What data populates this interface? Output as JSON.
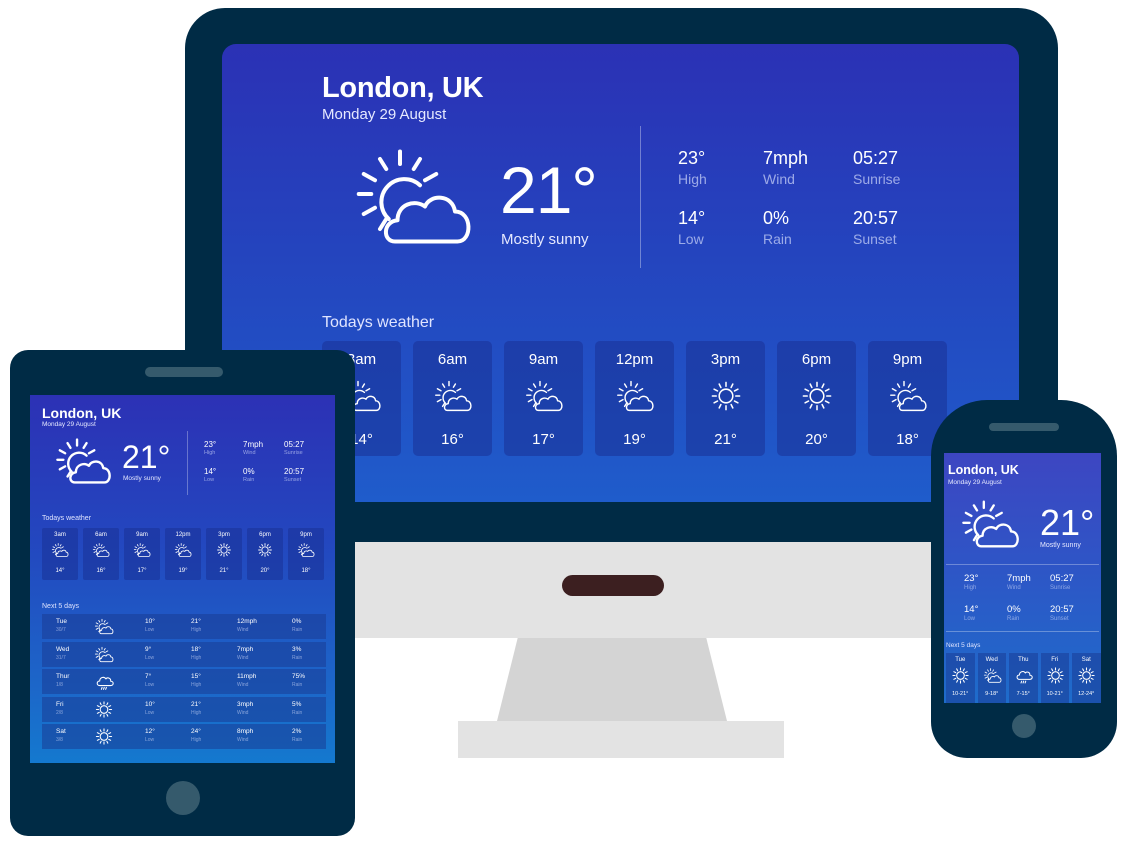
{
  "weather": {
    "city": "London, UK",
    "date": "Monday 29 August",
    "current": {
      "temperature": "21°",
      "condition": "Mostly sunny",
      "icon": "partly-sunny-icon"
    },
    "stats": [
      {
        "value": "23°",
        "label": "High"
      },
      {
        "value": "7mph",
        "label": "Wind"
      },
      {
        "value": "05:27",
        "label": "Sunrise"
      },
      {
        "value": "14°",
        "label": "Low"
      },
      {
        "value": "0%",
        "label": "Rain"
      },
      {
        "value": "20:57",
        "label": "Sunset"
      }
    ],
    "today_heading": "Todays weather",
    "hourly": [
      {
        "time": "3am",
        "icon": "partly-sunny-icon",
        "temp": "14°"
      },
      {
        "time": "6am",
        "icon": "partly-sunny-icon",
        "temp": "16°"
      },
      {
        "time": "9am",
        "icon": "partly-sunny-icon",
        "temp": "17°"
      },
      {
        "time": "12pm",
        "icon": "partly-sunny-icon",
        "temp": "19°"
      },
      {
        "time": "3pm",
        "icon": "sun-icon",
        "temp": "21°"
      },
      {
        "time": "6pm",
        "icon": "sun-icon",
        "temp": "20°"
      },
      {
        "time": "9pm",
        "icon": "partly-sunny-icon",
        "temp": "18°"
      }
    ],
    "next_heading": "Next 5 days",
    "daily_labels": {
      "low": "Low",
      "high": "High",
      "wind": "Wind",
      "rain": "Rain"
    },
    "daily": [
      {
        "day": "Tue",
        "date": "30/7",
        "icon": "partly-sunny-icon",
        "low": "10°",
        "high": "21°",
        "wind": "12mph",
        "rain": "0%",
        "range": "10-21°",
        "phone_icon": "sun-icon"
      },
      {
        "day": "Wed",
        "date": "31/7",
        "icon": "partly-sunny-icon",
        "low": "9°",
        "high": "18°",
        "wind": "7mph",
        "rain": "3%",
        "range": "9-18°",
        "phone_icon": "partly-sunny-icon"
      },
      {
        "day": "Thur",
        "date": "1/8",
        "icon": "rain-cloud-icon",
        "low": "7°",
        "high": "15°",
        "wind": "11mph",
        "rain": "75%",
        "range": "7-15°",
        "phone_label": "Thu",
        "phone_icon": "rain-cloud-icon"
      },
      {
        "day": "Fri",
        "date": "2/8",
        "icon": "sun-icon",
        "low": "10°",
        "high": "21°",
        "wind": "3mph",
        "rain": "5%",
        "range": "10-21°",
        "phone_icon": "sun-icon"
      },
      {
        "day": "Sat",
        "date": "3/8",
        "icon": "sun-icon",
        "low": "12°",
        "high": "24°",
        "wind": "8mph",
        "rain": "2%",
        "range": "12-24°",
        "phone_icon": "sun-icon"
      }
    ]
  },
  "colors": {
    "device_frame": "#002b45",
    "device_accent": "#355a6c",
    "screen_top": "#2b31b5",
    "screen_bottom": "#1479cf",
    "monitor_chin": "#e3e3e3",
    "monitor_logo": "#3c1f20",
    "monitor_stand": "#d4d4d4"
  }
}
